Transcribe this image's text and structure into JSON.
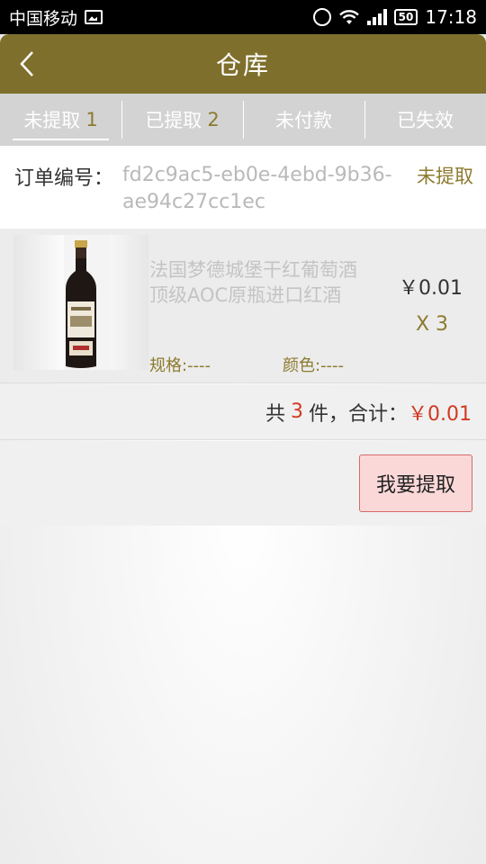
{
  "status_bar": {
    "carrier": "中国移动",
    "battery": "50",
    "time": "17:18"
  },
  "header": {
    "title": "仓库",
    "back_icon": "chevron-left-icon"
  },
  "tabs": [
    {
      "label": "未提取",
      "count": "1",
      "active": true
    },
    {
      "label": "已提取",
      "count": "2",
      "active": false
    },
    {
      "label": "未付款",
      "count": "",
      "active": false
    },
    {
      "label": "已失效",
      "count": "",
      "active": false
    }
  ],
  "order": {
    "label": "订单编号：",
    "id": "fd2c9ac5-eb0e-4ebd-9b36-ae94c27cc1ec",
    "status": "未提取"
  },
  "product": {
    "name": "法国梦德城堡干红葡萄酒 顶级AOC原瓶进口红酒",
    "spec": "规格:----",
    "color": "颜色:----",
    "price": "￥0.01",
    "qty": "X 3"
  },
  "summary": {
    "prefix": "共",
    "count": "3",
    "middle": "件，合计：",
    "total": "￥0.01"
  },
  "actions": {
    "extract_label": "我要提取"
  },
  "colors": {
    "header": "#7f6f2c",
    "accent": "#8c7a2e",
    "price_red": "#d13a21",
    "button_bg": "#fbd8d8",
    "button_border": "#d36a6a"
  }
}
